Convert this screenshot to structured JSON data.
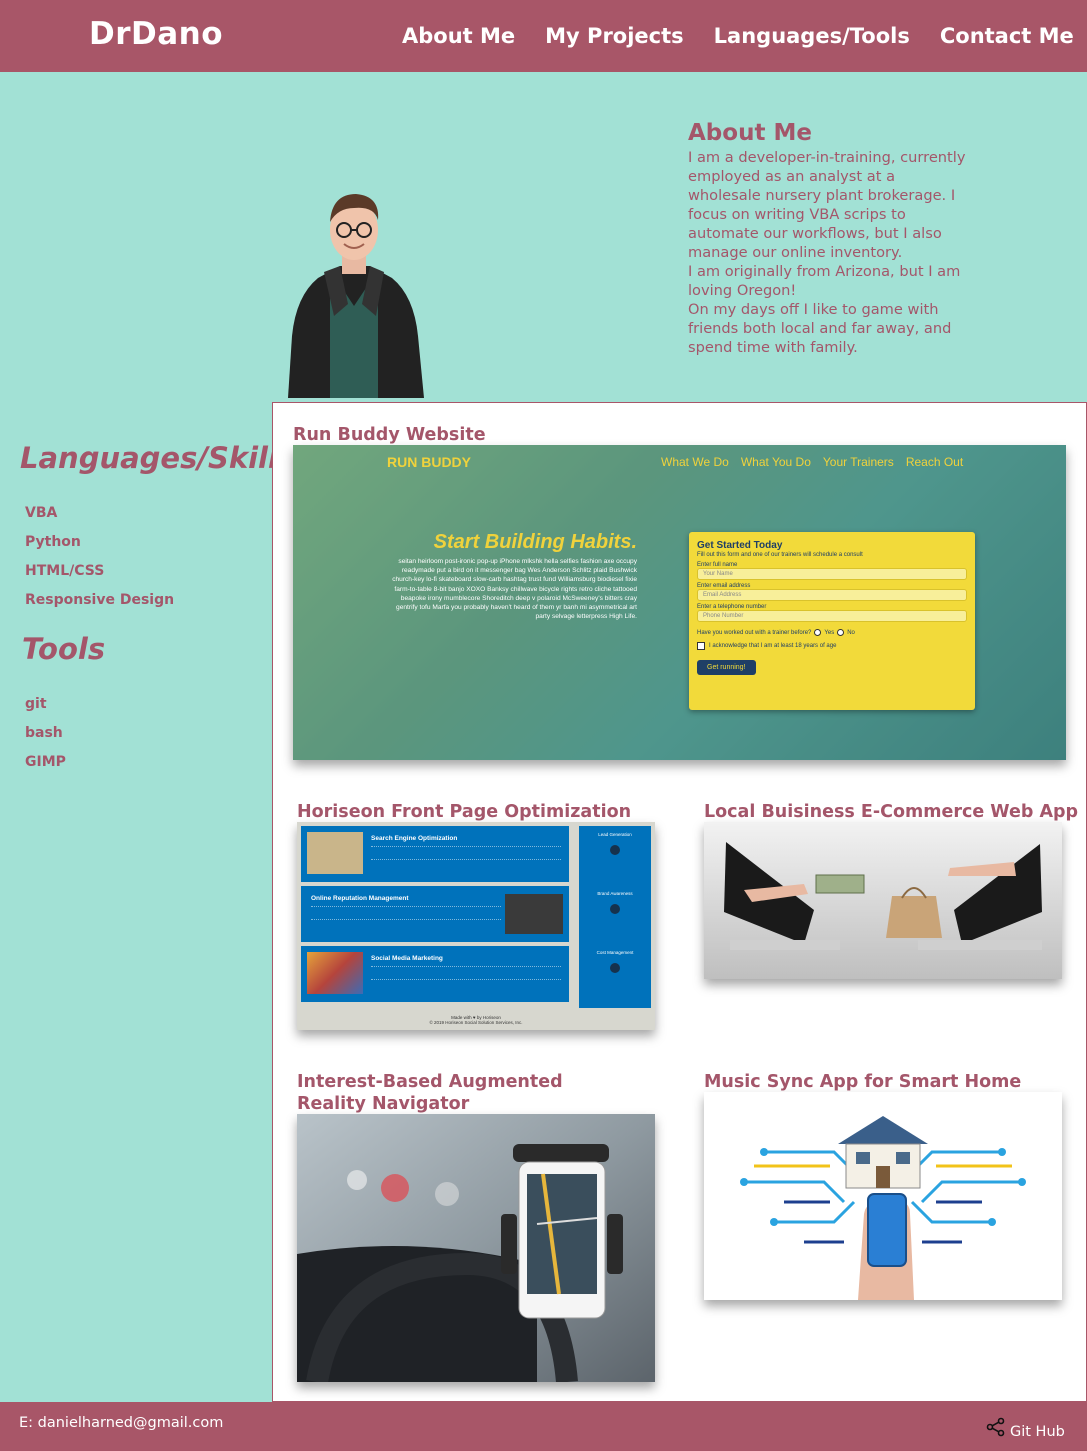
{
  "header": {
    "brand": "DrDano",
    "nav": [
      "About Me",
      "My Projects",
      "Languages/Tools",
      "Contact Me"
    ]
  },
  "about": {
    "title": "About Me",
    "paragraphs": [
      "I am a developer-in-training, currently employed as an analyst at a wholesale nursery plant brokerage. I focus on writing VBA scrips to automate our workflows, but I also manage our online inventory.",
      "I am originally from Arizona, but I am loving Oregon!",
      "On my days off I like to game with friends both local and far away, and spend time with family."
    ]
  },
  "sidebar": {
    "skills_title": "Languages/Skills",
    "skills": [
      "VBA",
      "Python",
      "HTML/CSS",
      "Responsive Design"
    ],
    "tools_title": "Tools",
    "tools": [
      "git",
      "bash",
      "GIMP"
    ]
  },
  "projects": {
    "items": [
      {
        "title": "Run Buddy Website"
      },
      {
        "title": "Horiseon Front Page Optimization"
      },
      {
        "title": "Local Buisiness E-Commerce Web App"
      },
      {
        "title": "Interest-Based Augmented Reality Navigator"
      },
      {
        "title": "Music Sync App for Smart Home"
      }
    ],
    "runbuddy": {
      "logo": "RUN BUDDY",
      "nav": [
        "What We Do",
        "What You Do",
        "Your Trainers",
        "Reach Out"
      ],
      "hero_title": "Start Building Habits.",
      "hero_text": "seitan heirloom post-ironic pop-up iPhone mlkshk hella selfies fashion axe occupy readymade put a bird on it messenger bag Wes Anderson Schlitz plaid Bushwick church-key lo-fi skateboard slow-carb hashtag trust fund Williamsburg biodiesel fixie farm-to-table 8-bit banjo XOXO Banksy chillwave bicycle rights retro cliche tattooed beapoke irony mumblecore Shoreditch deep v polaroid McSweeney's bitters cray gentrify tofu Marfa you probably haven't heard of them yr banh mi asymmetrical art party selvage letterpress High Life.",
      "form_title": "Get Started Today",
      "form_sub": "Fill out this form and one of our trainers will schedule a consult",
      "fields": [
        {
          "label": "Enter full name",
          "placeholder": "Your Name"
        },
        {
          "label": "Enter email address",
          "placeholder": "Email Address"
        },
        {
          "label": "Enter a telephone number",
          "placeholder": "Phone Number"
        }
      ],
      "question": "Have you worked out with a trainer before?",
      "yes": "Yes",
      "no": "No",
      "ack": "I acknowledge that I am at least 18 years of age",
      "cta": "Get running!"
    },
    "horiseon": {
      "sections": [
        "Search Engine Optimization",
        "Online Reputation Management",
        "Social Media Marketing"
      ],
      "aside": [
        "Lead Generation",
        "Brand Awareness",
        "Cost Management"
      ],
      "footer": "Made with ♥ by Horiseon",
      "copyright": "© 2019 Horiseon Social Solution Services, Inc."
    }
  },
  "footer": {
    "email": "E: danielharned@gmail.com",
    "github": "Git Hub"
  },
  "colors": {
    "accent": "#a85668",
    "background": "#a2e1d5",
    "text": "#a4566a"
  }
}
